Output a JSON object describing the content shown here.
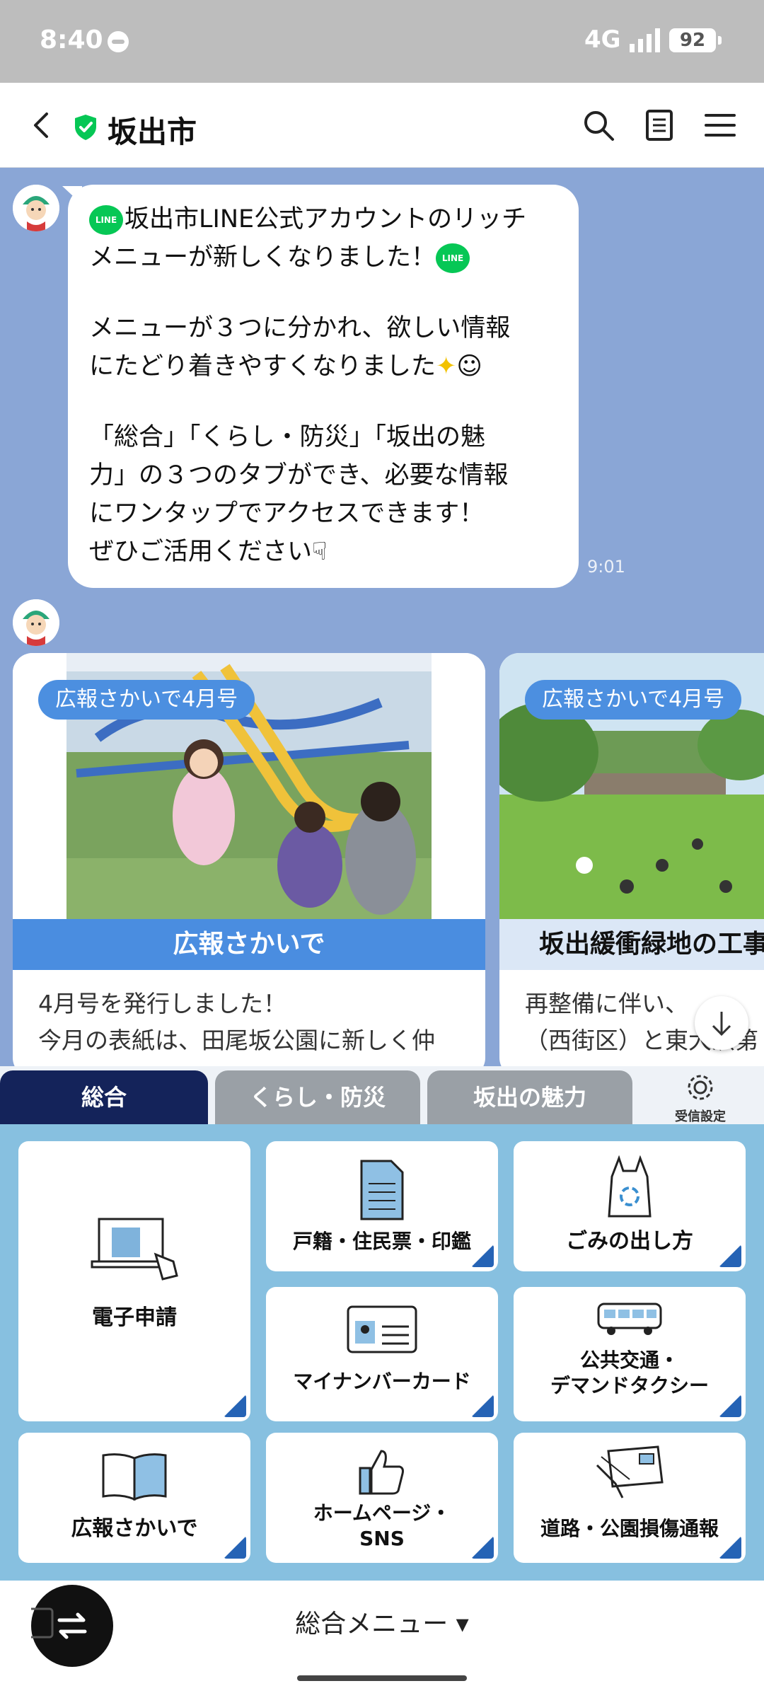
{
  "status_bar": {
    "time": "8:40",
    "network": "4G",
    "battery": "92"
  },
  "header": {
    "title": "坂出市"
  },
  "chat": {
    "message": {
      "line1": "坂出市LINE公式アカウントのリッチ",
      "line2": "メニューが新しくなりました！",
      "line3": "メニューが３つに分かれ、欲しい情報",
      "line4": "にたどり着きやすくなりました",
      "line5": "「総合」「くらし・防災」「坂出の魅",
      "line6": "力」の３つのタブができ、必要な情報",
      "line7": "にワンタップでアクセスできます！",
      "line8": "ぜひご活用ください",
      "time": "9:01",
      "line_badge": "LINE"
    },
    "cards": [
      {
        "tag": "広報さかいで4月号",
        "title": "広報さかいで",
        "body1": "4月号を発行しました！",
        "body2": "今月の表紙は、田尾坂公園に新しく仲"
      },
      {
        "tag": "広報さかいで4月号",
        "title": "坂出緩衝緑地の工事",
        "body1": "再整備に伴い、",
        "body2": "（西街区）と東大浜第"
      }
    ]
  },
  "richmenu": {
    "tabs": [
      "総合",
      "くらし・防災",
      "坂出の魅力"
    ],
    "settings_label": "受信設定",
    "tiles": {
      "e_application": "電子申請",
      "koseki": "戸籍・住民票・印鑑",
      "gomi": "ごみの出し方",
      "mynumber": "マイナンバーカード",
      "transport_1": "公共交通・",
      "transport_2": "デマンドタクシー",
      "koho": "広報さかいで",
      "homepage_1": "ホームページ・",
      "homepage_2": "SNS",
      "road": "道路・公園損傷通報"
    }
  },
  "bottom": {
    "menu_label": "総合メニュー ▾"
  }
}
